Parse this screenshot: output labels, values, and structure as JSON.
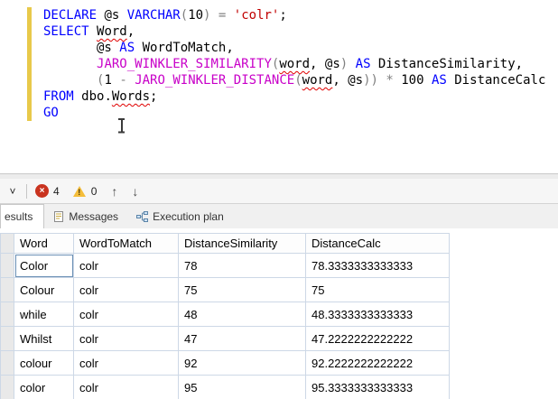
{
  "editor": {
    "lines": [
      {
        "tokens": [
          {
            "t": "DECLARE ",
            "c": "kw"
          },
          {
            "t": "@s ",
            "c": "id"
          },
          {
            "t": "VARCHAR",
            "c": "kw"
          },
          {
            "t": "(",
            "c": "op"
          },
          {
            "t": "10",
            "c": "id"
          },
          {
            "t": ")",
            "c": "op"
          },
          {
            "t": " = ",
            "c": "op"
          },
          {
            "t": "'colr'",
            "c": "str"
          },
          {
            "t": ";",
            "c": "id"
          }
        ]
      },
      {
        "tokens": [
          {
            "t": "SELECT ",
            "c": "kw"
          },
          {
            "t": "Word",
            "c": "id",
            "sq": true
          },
          {
            "t": ",",
            "c": "id"
          }
        ]
      },
      {
        "tokens": [
          {
            "t": "       @s ",
            "c": "id"
          },
          {
            "t": "AS",
            "c": "kw"
          },
          {
            "t": " WordToMatch",
            "c": "id"
          },
          {
            "t": ",",
            "c": "id"
          }
        ]
      },
      {
        "tokens": [
          {
            "t": "       ",
            "c": "id"
          },
          {
            "t": "JARO_WINKLER_SIMILARITY",
            "c": "fn"
          },
          {
            "t": "(",
            "c": "op"
          },
          {
            "t": "word",
            "c": "id",
            "sq": true
          },
          {
            "t": ", @s",
            "c": "id"
          },
          {
            "t": ")",
            "c": "op"
          },
          {
            "t": " ",
            "c": "id"
          },
          {
            "t": "AS",
            "c": "kw"
          },
          {
            "t": " DistanceSimilarity,",
            "c": "id"
          }
        ]
      },
      {
        "tokens": [
          {
            "t": "       ",
            "c": "id"
          },
          {
            "t": "(",
            "c": "op"
          },
          {
            "t": "1",
            "c": "id"
          },
          {
            "t": " - ",
            "c": "op"
          },
          {
            "t": "JARO_WINKLER_DISTANCE",
            "c": "fn"
          },
          {
            "t": "(",
            "c": "op"
          },
          {
            "t": "word",
            "c": "id",
            "sq": true
          },
          {
            "t": ", @s",
            "c": "id"
          },
          {
            "t": "))",
            "c": "op"
          },
          {
            "t": " * ",
            "c": "op"
          },
          {
            "t": "100 ",
            "c": "id"
          },
          {
            "t": "AS",
            "c": "kw"
          },
          {
            "t": " DistanceCalc",
            "c": "id"
          }
        ]
      },
      {
        "tokens": [
          {
            "t": "FROM ",
            "c": "kw"
          },
          {
            "t": "dbo.",
            "c": "id"
          },
          {
            "t": "Words",
            "c": "id",
            "sq": true
          },
          {
            "t": ";",
            "c": "id"
          }
        ]
      },
      {
        "tokens": [
          {
            "t": "GO",
            "c": "kw"
          }
        ]
      }
    ]
  },
  "toolbar": {
    "error_count": "4",
    "warning_count": "0"
  },
  "icons": {
    "chevron": "˅",
    "error_x": "×",
    "warning_mark": "!",
    "up_arrow": "↑",
    "down_arrow": "↓"
  },
  "tabs": [
    {
      "label": "esults",
      "active": true
    },
    {
      "label": "Messages",
      "active": false
    },
    {
      "label": "Execution plan",
      "active": false
    }
  ],
  "grid": {
    "columns": [
      "Word",
      "WordToMatch",
      "DistanceSimilarity",
      "DistanceCalc"
    ],
    "rows": [
      [
        "Color",
        "colr",
        "78",
        "78.3333333333333"
      ],
      [
        "Colour",
        "colr",
        "75",
        "75"
      ],
      [
        "while",
        "colr",
        "48",
        "48.3333333333333"
      ],
      [
        "Whilst",
        "colr",
        "47",
        "47.2222222222222"
      ],
      [
        "colour",
        "colr",
        "92",
        "92.2222222222222"
      ],
      [
        "color",
        "colr",
        "95",
        "95.3333333333333"
      ]
    ],
    "selected_cell": {
      "row": 0,
      "col": 0
    }
  },
  "colors": {
    "keyword_blue": "#0000ff",
    "function_magenta": "#c800c8",
    "string_red": "#c00000",
    "operator_gray": "#808080",
    "grid_line": "#cdd8e6",
    "error_red": "#c9331f",
    "warning_yellow": "#f4bd3a",
    "change_bar_yellow": "#e8c94a"
  }
}
